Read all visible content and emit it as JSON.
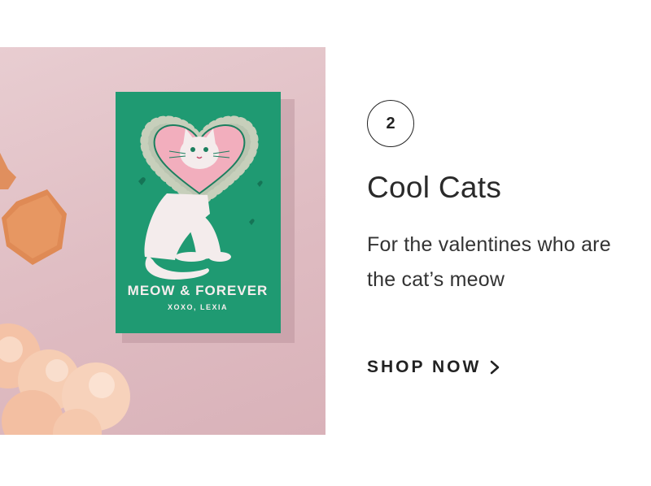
{
  "feature": {
    "step_number": "2",
    "title": "Cool Cats",
    "description": "For the valentines who are the cat’s meow",
    "cta_label": "SHOP NOW",
    "cta_icon": "chevron-right-icon"
  },
  "product_image": {
    "card_heading": "MEOW & FOREVER",
    "card_signature": "XOXO, LEXIA"
  },
  "colors": {
    "card_green": "#1f9a72",
    "heart_pink": "#f2aebd",
    "background_pink": "#e3c3c8",
    "text_dark": "#2a2a2a"
  }
}
